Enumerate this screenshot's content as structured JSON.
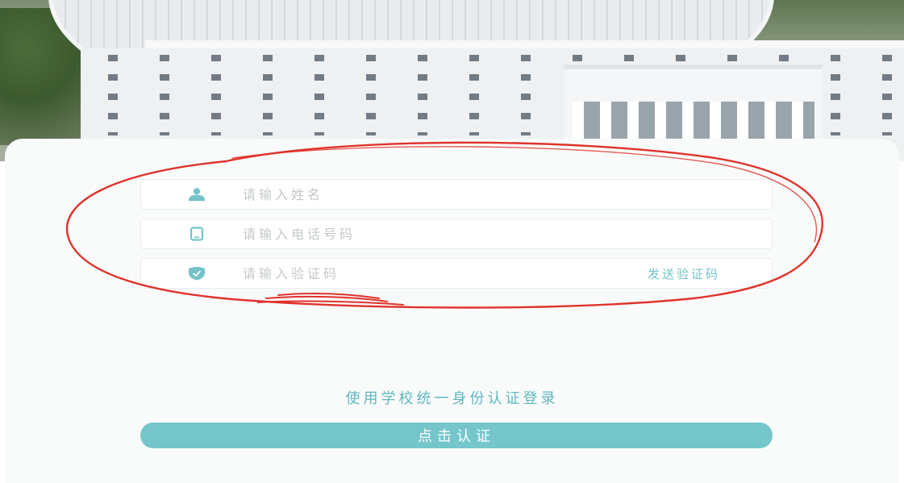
{
  "form": {
    "name_field": {
      "placeholder": "请输入姓名",
      "value": "",
      "icon": "user-icon"
    },
    "phone_field": {
      "placeholder": "请输入电话号码",
      "value": "",
      "icon": "phone-icon"
    },
    "code_field": {
      "placeholder": "请输入验证码",
      "value": "",
      "icon": "shield-icon"
    },
    "send_code_label": "发送验证码"
  },
  "sso_link_label": "使用学校统一身份认证登录",
  "submit_label": "点击认证",
  "colors": {
    "accent": "#74c6cb",
    "accent_text": "#5fb7bf",
    "icon": "#74c3c9",
    "annotation": "#e0322b"
  }
}
